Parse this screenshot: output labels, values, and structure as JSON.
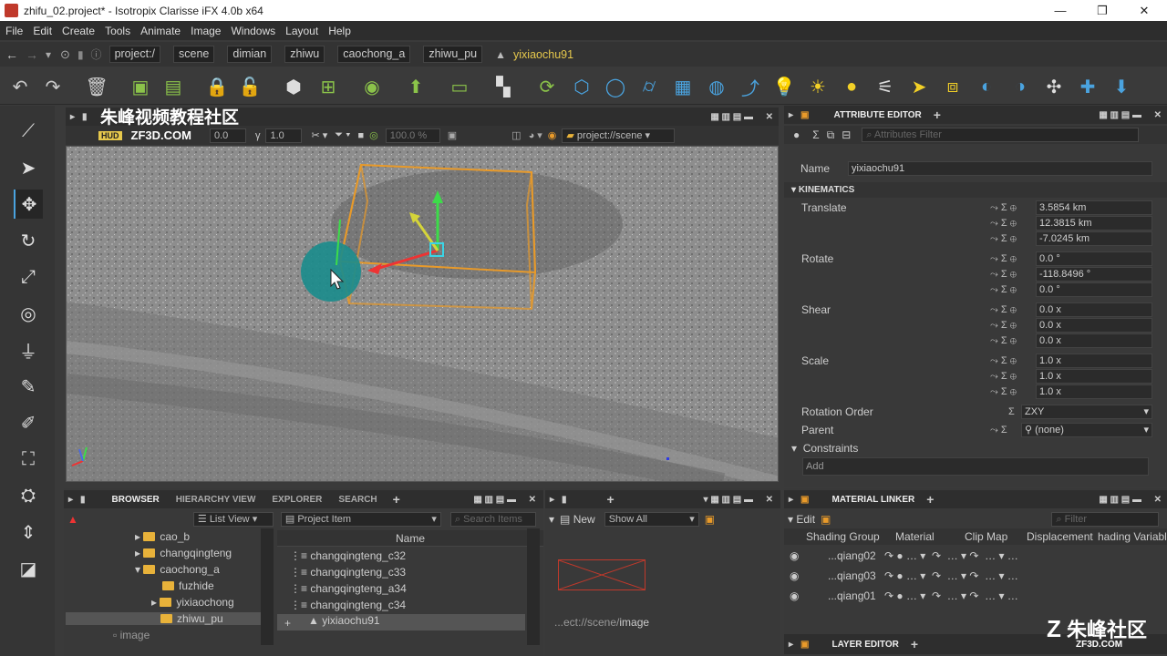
{
  "window": {
    "title": "zhifu_02.project* - Isotropix Clarisse iFX 4.0b x64",
    "min": "—",
    "max": "❐",
    "close": "✕"
  },
  "menu": [
    "File",
    "Edit",
    "Create",
    "Tools",
    "Animate",
    "Image",
    "Windows",
    "Layout",
    "Help"
  ],
  "path": {
    "crumbs": [
      "project:/",
      "scene",
      "dimian",
      "zhiwu",
      "caochong_a",
      "zhiwu_pu"
    ],
    "selected": "yixiaochu91"
  },
  "watermark": {
    "top": "朱峰视频教程社区",
    "sub": "ZF3D.COM",
    "corner": "朱峰社区",
    "corner_sub": "ZF3D.COM"
  },
  "viewport": {
    "hud": "HUD",
    "field1": "0.0",
    "field2": "1.0",
    "zoom": "100.0 %",
    "context": "project://scene"
  },
  "attribute_editor": {
    "title": "ATTRIBUTE EDITOR",
    "filter_placeholder": "Attributes Filter",
    "name_label": "Name",
    "name_value": "yixiaochu91",
    "section": "KINEMATICS",
    "translate_label": "Translate",
    "translate": [
      "3.5854 km",
      "12.3815 km",
      "-7.0245 km"
    ],
    "rotate_label": "Rotate",
    "rotate": [
      "0.0 °",
      "-118.8496 °",
      "0.0 °"
    ],
    "shear_label": "Shear",
    "shear": [
      "0.0 x",
      "0.0 x",
      "0.0 x"
    ],
    "scale_label": "Scale",
    "scale": [
      "1.0 x",
      "1.0 x",
      "1.0 x"
    ],
    "rotation_order_label": "Rotation Order",
    "rotation_order": "ZXY",
    "parent_label": "Parent",
    "parent": "(none)",
    "constraints_label": "Constraints",
    "add": "Add"
  },
  "browser": {
    "tabs": [
      "BROWSER",
      "HIERARCHY VIEW",
      "EXPLORER",
      "SEARCH"
    ],
    "list_view": "List View",
    "project_item": "Project Item",
    "search_placeholder": "Search Items",
    "column": "Name",
    "tree": [
      "cao_b",
      "changqingteng",
      "caochong_a",
      "fuzhide",
      "yixiaochong",
      "zhiwu_pu",
      "image"
    ],
    "items": [
      "changqingteng_c32",
      "changqingteng_c33",
      "changqingteng_a34",
      "changqingteng_c34",
      "yixiaochu91"
    ]
  },
  "image_view": {
    "new": "New",
    "show": "Show All",
    "path_prefix": "...ect://scene/",
    "path_tail": "image"
  },
  "material_linker": {
    "title": "MATERIAL LINKER",
    "edit": "Edit",
    "filter_placeholder": "Filter",
    "columns": [
      "Shading Group",
      "Material",
      "Clip Map",
      "Displacement",
      "hading Variabl"
    ],
    "rows": [
      "...qiang02",
      "...qiang03",
      "...qiang01"
    ]
  },
  "layer_editor": {
    "title": "LAYER EDITOR"
  },
  "colors": {
    "accent": "#4aa3df",
    "selection": "#e6c84c",
    "bbox": "#e89a2a"
  }
}
